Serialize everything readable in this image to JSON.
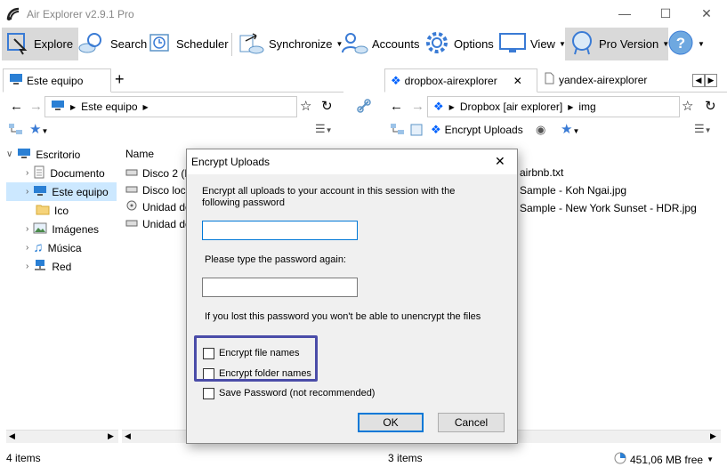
{
  "window": {
    "title": "Air Explorer v2.9.1 Pro"
  },
  "toolbar": {
    "explore": "Explore",
    "search": "Search",
    "scheduler": "Scheduler",
    "synchronize": "Synchronize",
    "accounts": "Accounts",
    "options": "Options",
    "view": "View",
    "pro_version": "Pro Version"
  },
  "left_panel": {
    "tab_label": "Este equipo",
    "address": "Este equipo",
    "column_name": "Name",
    "tree": [
      "Escritorio",
      "Documento",
      "Este equipo",
      "Ico",
      "Imágenes",
      "Música",
      "Red"
    ],
    "files": [
      "Disco 2 (F:",
      "Disco loca",
      "Unidad de",
      "Unidad de"
    ],
    "status": "4 items"
  },
  "right_panel": {
    "tabs": [
      "dropbox-airexplorer",
      "yandex-airexplorer"
    ],
    "address_account": "Dropbox [air explorer]",
    "address_folder": "img",
    "encrypt_uploads": "Encrypt Uploads",
    "files": [
      "airbnb.txt",
      "Sample - Koh Ngai.jpg",
      "Sample - New York Sunset - HDR.jpg"
    ],
    "status": "3 items",
    "free_space": "451,06 MB free"
  },
  "dialog": {
    "title": "Encrypt Uploads",
    "intro": "Encrypt all uploads to your account in this session with the following password",
    "password_value": "",
    "retype_label": "Please type the password again:",
    "retype_value": "",
    "warning": "If you lost this password you won't be able to unencrypt the files",
    "encrypt_file_names": "Encrypt file names",
    "encrypt_folder_names": "Encrypt folder names",
    "save_password": "Save Password (not recommended)",
    "ok": "OK",
    "cancel": "Cancel"
  },
  "colors": {
    "accent": "#0078d7",
    "highlight_box": "#4a4ca8",
    "selection": "#cce8ff"
  }
}
